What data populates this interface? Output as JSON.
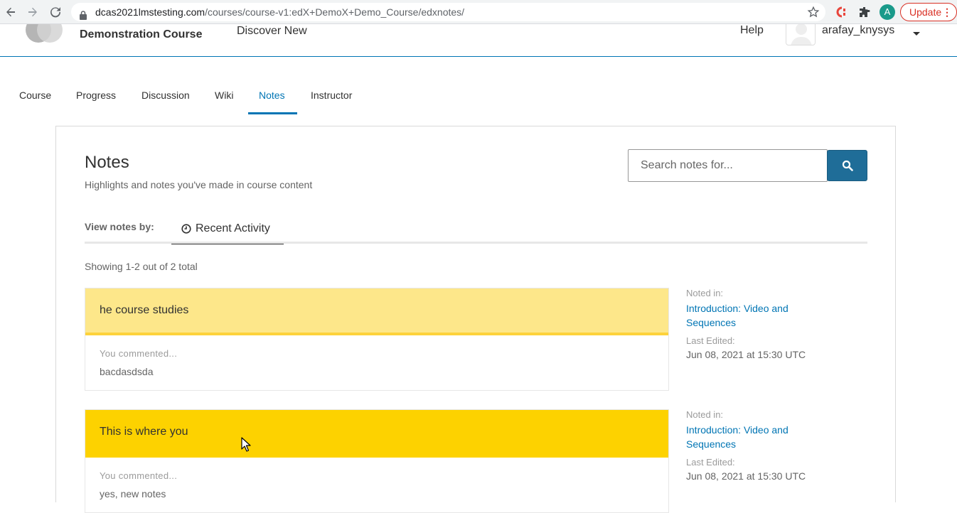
{
  "browser": {
    "url_host": "dcas2021lmstesting.com",
    "url_path": "/courses/course-v1:edX+DemoX+Demo_Course/edxnotes/",
    "profile_initial": "A",
    "update_label": "Update"
  },
  "header": {
    "course_title": "Demonstration Course",
    "discover": "Discover New",
    "help": "Help",
    "username": "arafay_knysys"
  },
  "tabs": [
    {
      "label": "Course"
    },
    {
      "label": "Progress"
    },
    {
      "label": "Discussion"
    },
    {
      "label": "Wiki"
    },
    {
      "label": "Notes"
    },
    {
      "label": "Instructor"
    }
  ],
  "notes_page": {
    "title": "Notes",
    "subtitle": "Highlights and notes you've made in course content",
    "search_placeholder": "Search notes for...",
    "view_by_label": "View notes by:",
    "view_by_tab": "Recent Activity",
    "showing": "Showing 1-2 out of 2 total"
  },
  "notes": [
    {
      "highlight": "he course studies",
      "comment_label": "You commented...",
      "comment": "bacdasdsda",
      "noted_in_label": "Noted in:",
      "noted_in": "Introduction: Video and Sequences",
      "last_edited_label": "Last Edited:",
      "last_edited": "Jun 08, 2021 at 15:30 UTC"
    },
    {
      "highlight": "This is where you",
      "comment_label": "You commented...",
      "comment": "yes, new notes",
      "noted_in_label": "Noted in:",
      "noted_in": "Introduction: Video and Sequences",
      "last_edited_label": "Last Edited:",
      "last_edited": "Jun 08, 2021 at 15:30 UTC"
    }
  ],
  "colors": {
    "accent": "#0075b4",
    "highlight_light": "#fde78a",
    "highlight_strong": "#fdd200",
    "search_button": "#1f6d98"
  }
}
